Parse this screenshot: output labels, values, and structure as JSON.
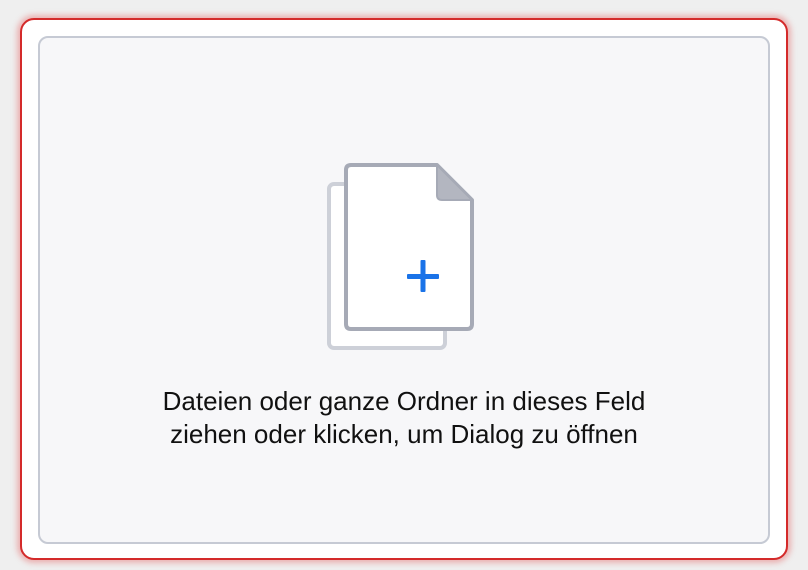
{
  "dropzone": {
    "line1": "Dateien oder ganze Ordner in dieses Feld",
    "line2": "ziehen oder klicken, um Dialog zu öffnen",
    "icon": "add-file-icon"
  },
  "colors": {
    "frame_border": "#d42a2a",
    "dropzone_border": "#c6cad4",
    "dropzone_background": "#f7f7f9",
    "document_stroke": "#a6aab6",
    "plus_accent": "#1a73e8"
  }
}
